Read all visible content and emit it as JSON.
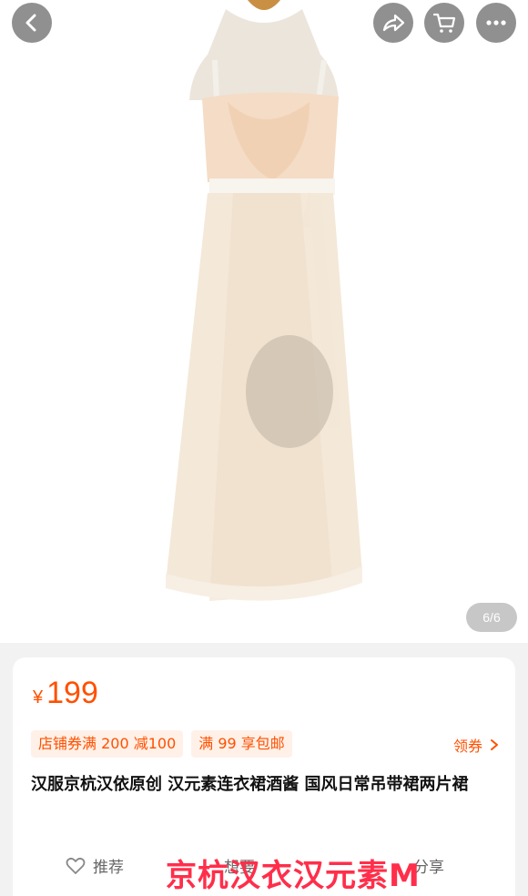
{
  "topbar": {
    "back_icon": "chevron-left-icon",
    "share_icon": "share-arrow-icon",
    "cart_icon": "shopping-cart-icon",
    "more_icon": "more-dots-icon"
  },
  "gallery": {
    "counter": "6/6",
    "image_subject": "dress-on-mannequin"
  },
  "product": {
    "currency": "¥",
    "price": "199",
    "tags": [
      "店铺券满 200 减100",
      "满 99 享包邮"
    ],
    "coupon_label": "领券",
    "title": "汉服京杭汉依原创 汉元素连衣裙酒酱 国风日常吊带裙两片裙"
  },
  "actions": {
    "recommend_label": "推荐",
    "want_label": "想要",
    "share_label": "分享"
  },
  "overlay": {
    "watermark_text": "京杭汉衣汉元素M"
  },
  "colors": {
    "accent": "#ff5000",
    "tag_bg": "#fff1e8",
    "watermark": "#ff2e4a"
  }
}
